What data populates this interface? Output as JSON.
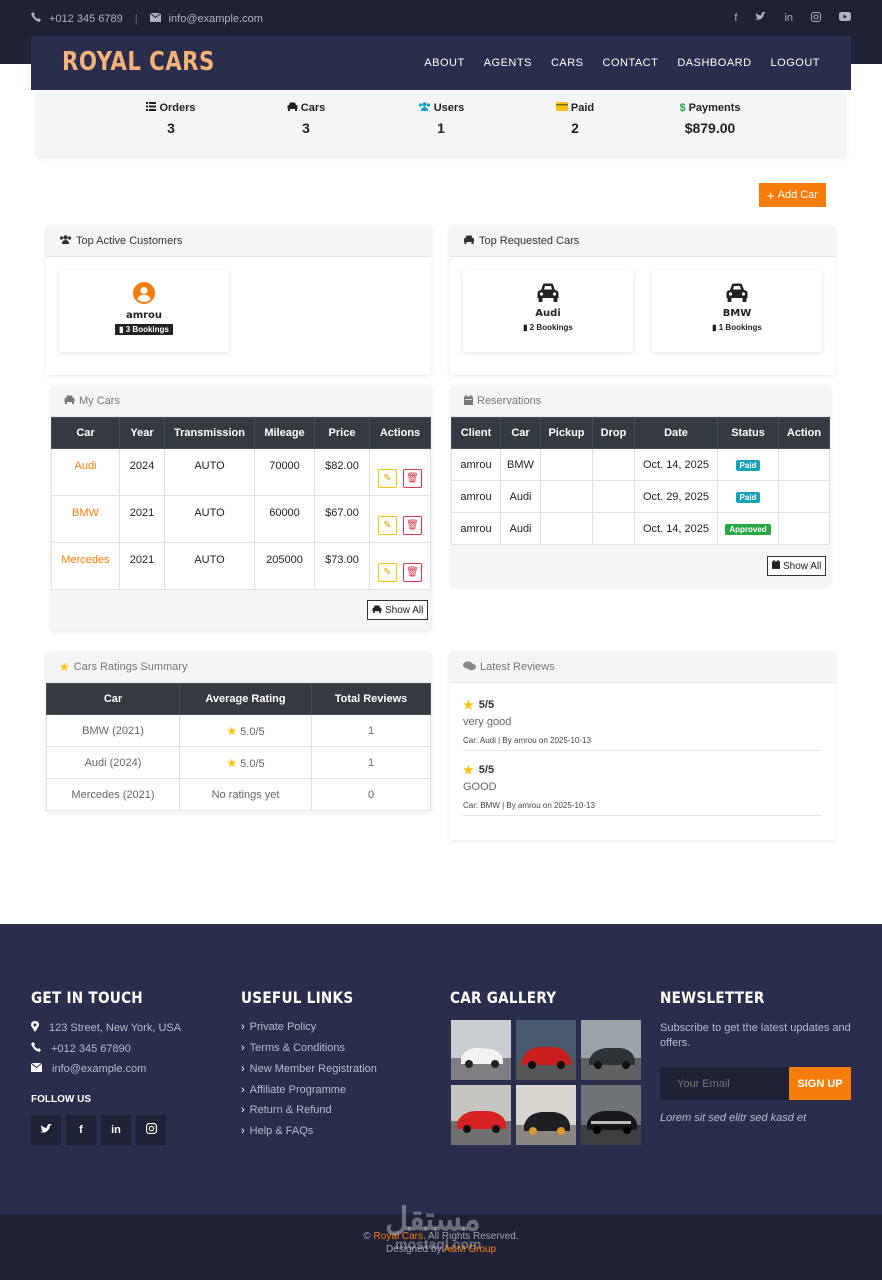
{
  "topbar": {
    "phone": "+012 345 6789",
    "email": "info@example.com",
    "social_icons": [
      "facebook-icon",
      "twitter-icon",
      "linkedin-icon",
      "instagram-icon",
      "youtube-icon"
    ]
  },
  "nav": {
    "brand": "ROYAL CARS",
    "links": [
      "ABOUT",
      "AGENTS",
      "CARS",
      "CONTACT",
      "DASHBOARD",
      "LOGOUT"
    ]
  },
  "stats": [
    {
      "label": "Orders",
      "value": "3",
      "icon": "list-icon"
    },
    {
      "label": "Cars",
      "value": "3",
      "icon": "car-icon"
    },
    {
      "label": "Users",
      "value": "1",
      "icon": "users-icon"
    },
    {
      "label": "Paid",
      "value": "2",
      "icon": "credit-card-icon"
    },
    {
      "label": "Payments",
      "value": "$879.00",
      "icon": "dollar-icon"
    }
  ],
  "add_car_label": "Add Car",
  "top_customers": {
    "title": "Top Active Customers",
    "items": [
      {
        "name": "amrou",
        "bookings": "3 Bookings"
      }
    ]
  },
  "top_cars": {
    "title": "Top Requested Cars",
    "items": [
      {
        "name": "Audi",
        "bookings": "2 Bookings"
      },
      {
        "name": "BMW",
        "bookings": "1 Bookings"
      }
    ]
  },
  "my_cars": {
    "title": "My Cars",
    "headers": [
      "Car",
      "Year",
      "Transmission",
      "Mileage",
      "Price",
      "Actions"
    ],
    "rows": [
      {
        "car": "Audi",
        "year": "2024",
        "transmission": "AUTO",
        "mileage": "70000",
        "price": "$82.00"
      },
      {
        "car": "BMW",
        "year": "2021",
        "transmission": "AUTO",
        "mileage": "60000",
        "price": "$67.00"
      },
      {
        "car": "Mercedes",
        "year": "2021",
        "transmission": "AUTO",
        "mileage": "205000",
        "price": "$73.00"
      }
    ],
    "show_all": "Show All"
  },
  "reservations": {
    "title": "Reservations",
    "headers": [
      "Client",
      "Car",
      "Pickup",
      "Drop",
      "Date",
      "Status",
      "Action"
    ],
    "rows": [
      {
        "client": "amrou",
        "car": "BMW",
        "pickup": "",
        "drop": "",
        "date": "Oct. 14, 2025",
        "status": "Paid"
      },
      {
        "client": "amrou",
        "car": "Audi",
        "pickup": "",
        "drop": "",
        "date": "Oct. 29, 2025",
        "status": "Paid"
      },
      {
        "client": "amrou",
        "car": "Audi",
        "pickup": "",
        "drop": "",
        "date": "Oct. 14, 2025",
        "status": "Approved"
      }
    ],
    "show_all": "Show All"
  },
  "ratings": {
    "title": "Cars Ratings Summary",
    "headers": [
      "Car",
      "Average Rating",
      "Total Reviews"
    ],
    "rows": [
      {
        "car": "BMW (2021)",
        "rating": "5.0/5",
        "total": "1"
      },
      {
        "car": "Audi (2024)",
        "rating": "5.0/5",
        "total": "1"
      },
      {
        "car": "Mercedes (2021)",
        "rating": "No ratings yet",
        "total": "0"
      }
    ]
  },
  "reviews": {
    "title": "Latest Reviews",
    "items": [
      {
        "score": "5/5",
        "text": "very good",
        "meta": "Car: Audi | By amrou on 2025-10-13"
      },
      {
        "score": "5/5",
        "text": "GOOD",
        "meta": "Car: BMW | By amrou on 2025-10-13"
      }
    ]
  },
  "footer": {
    "contact_title": "GET IN TOUCH",
    "address": "123 Street, New York, USA",
    "phone": "+012 345 67890",
    "email": "info@example.com",
    "follow_title": "FOLLOW US",
    "links_title": "USEFUL LINKS",
    "links": [
      "Private Policy",
      "Terms & Conditions",
      "New Member Registration",
      "Affiliate Programme",
      "Return & Refund",
      "Help & FAQs"
    ],
    "gallery_title": "CAR GALLERY",
    "newsletter_title": "NEWSLETTER",
    "newsletter_text": "Subscribe to get the latest updates and offers.",
    "email_placeholder": "Your Email",
    "signup_label": "SIGN UP",
    "lorem": "Lorem sit sed elitr sed kasd et"
  },
  "copyright": {
    "prefix": "©",
    "brand": "Royal Cars",
    "suffix": ". All Rights Reserved.",
    "designed_by": "Designed by",
    "designer": "A&M Group"
  },
  "watermark": {
    "arabic": "مستقل",
    "latin": "mostaql.com"
  },
  "colors": {
    "accent": "#f77d0a",
    "navy": "#2b2d4d",
    "dark_navy": "#1f2137",
    "brand_text": "#f3b27a"
  }
}
